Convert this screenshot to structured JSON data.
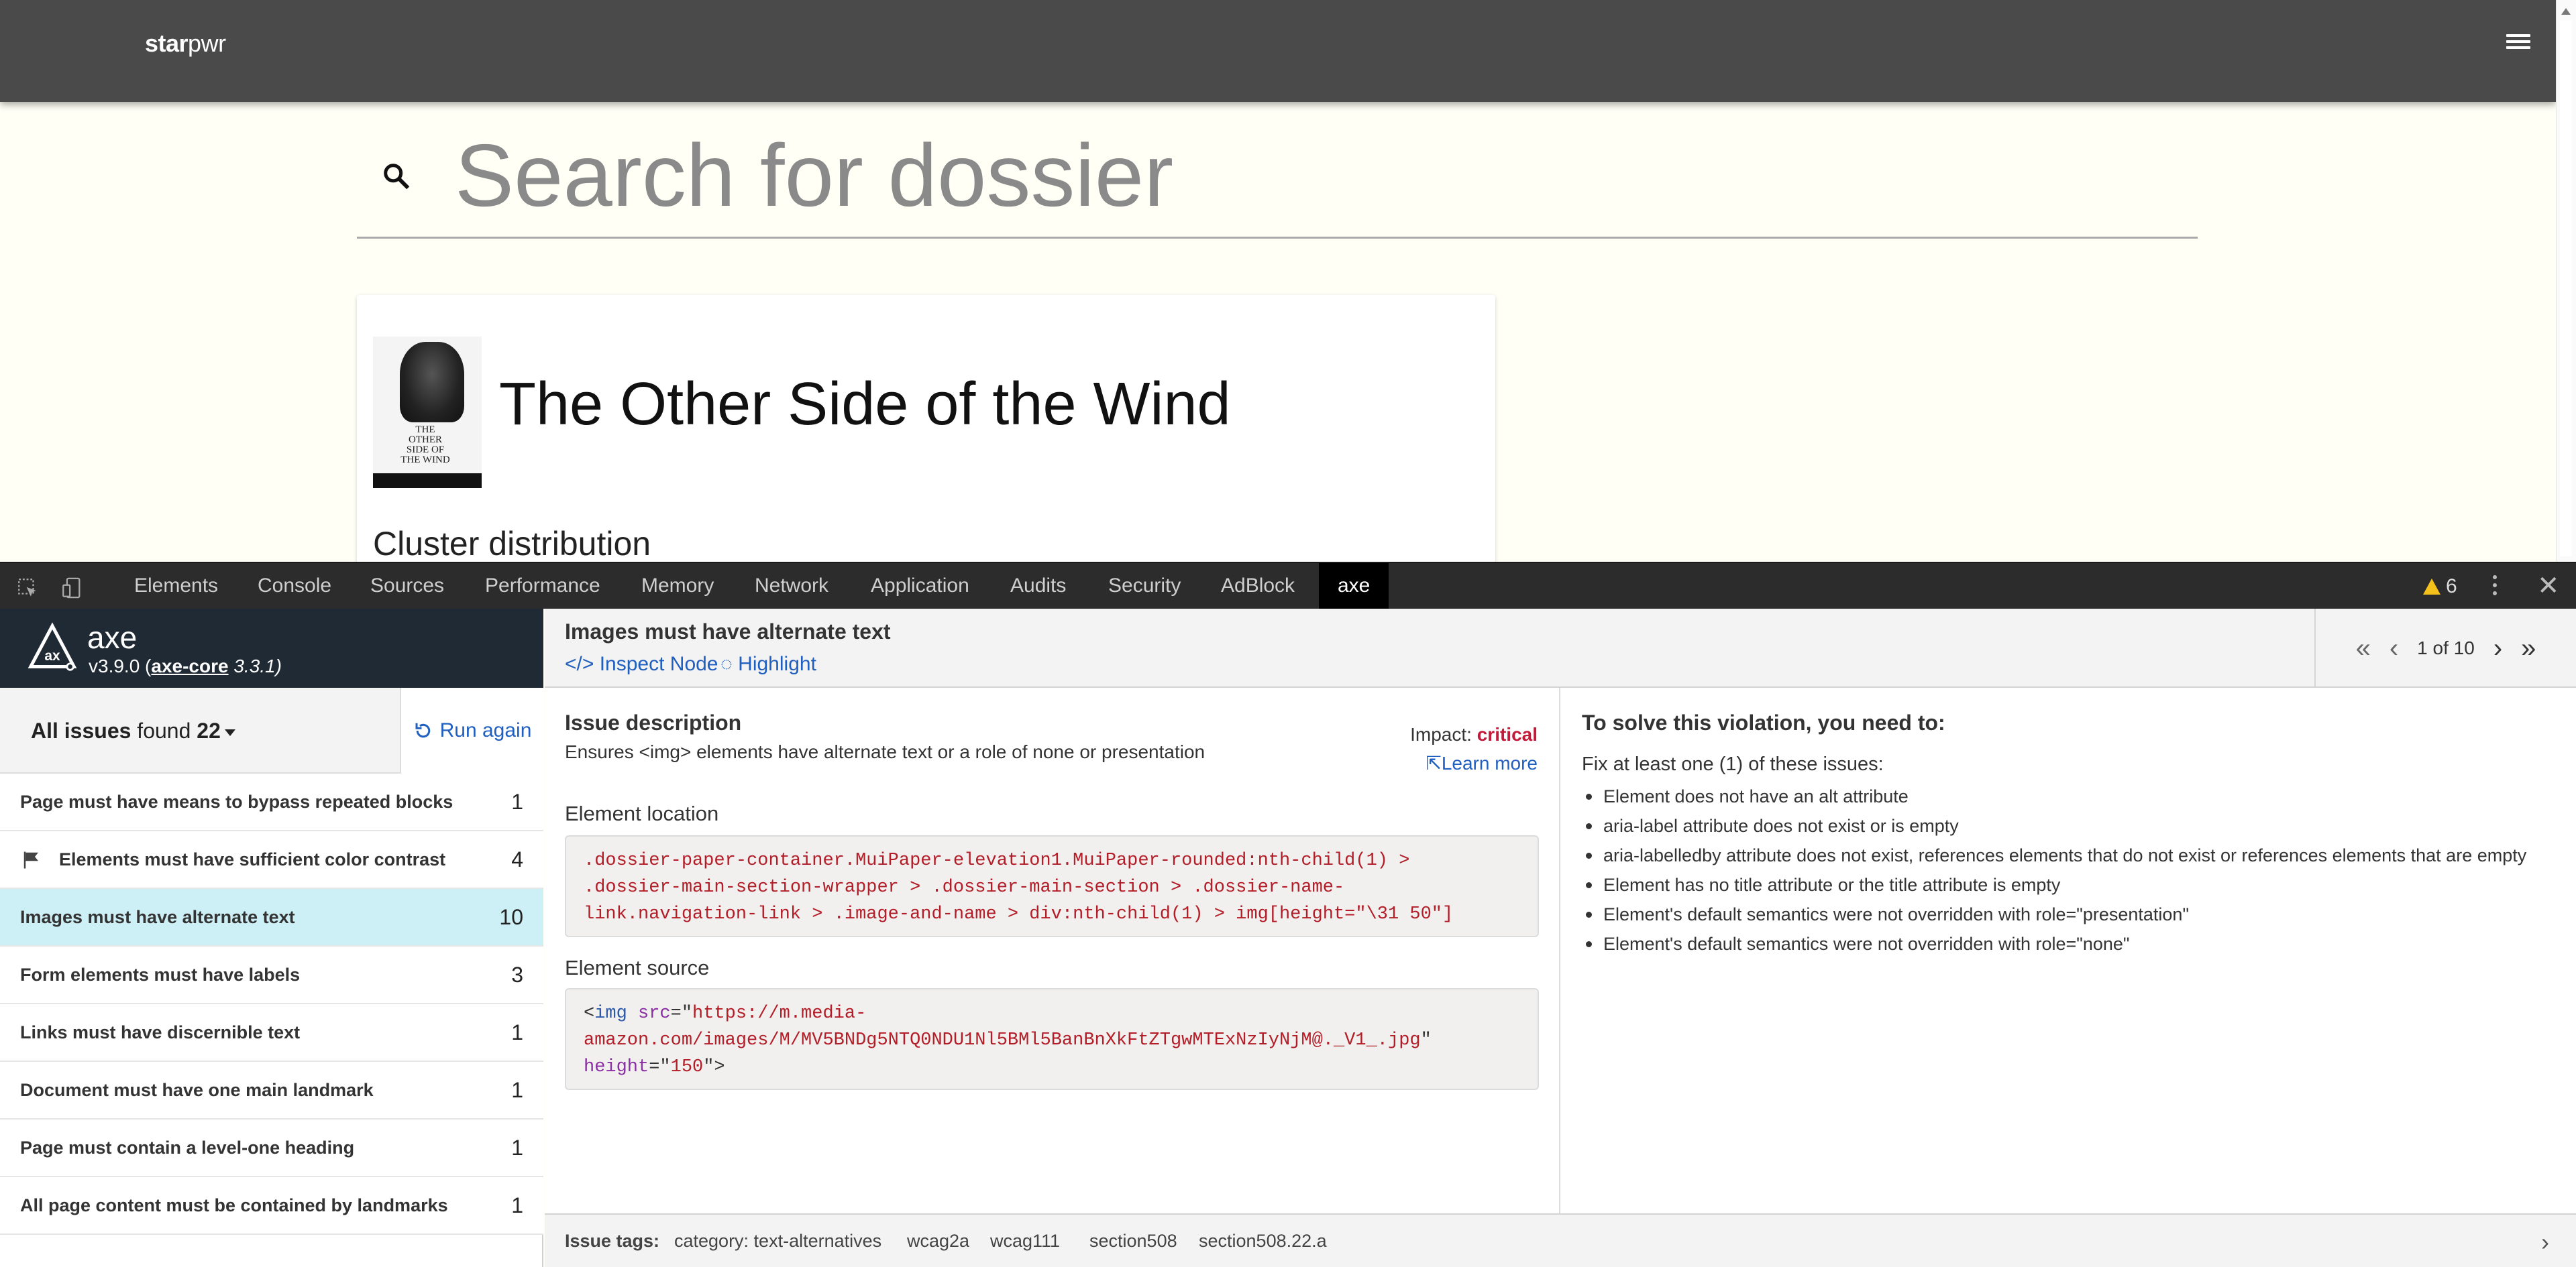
{
  "app": {
    "logo_bold": "star",
    "logo_rest": "pwr"
  },
  "search": {
    "placeholder": "Search for dossier"
  },
  "card": {
    "title": "The Other Side of the Wind",
    "section_heading": "Cluster distribution",
    "poster_text": "THE OTHER SIDE OF THE WIND"
  },
  "devtools": {
    "tabs": [
      "Elements",
      "Console",
      "Sources",
      "Performance",
      "Memory",
      "Network",
      "Application",
      "Audits",
      "Security",
      "AdBlock",
      "axe"
    ],
    "active_tab": "axe",
    "warning_count": "6"
  },
  "axe": {
    "name": "axe",
    "version_prefix": "v3.9.0 (",
    "core_link": "axe-core",
    "core_version": " 3.3.1)",
    "filter_label": "All issues",
    "found_label": " found ",
    "found_count": "22",
    "run_again": "Run again",
    "issues": [
      {
        "label": "Page must have means to bypass repeated blocks",
        "count": "1"
      },
      {
        "label": "Elements must have sufficient color contrast",
        "count": "4"
      },
      {
        "label": "Images must have alternate text",
        "count": "10"
      },
      {
        "label": "Form elements must have labels",
        "count": "3"
      },
      {
        "label": "Links must have discernible text",
        "count": "1"
      },
      {
        "label": "Document must have one main landmark",
        "count": "1"
      },
      {
        "label": "Page must contain a level-one heading",
        "count": "1"
      },
      {
        "label": "All page content must be contained by landmarks",
        "count": "1"
      }
    ],
    "selected_issue": 2
  },
  "rule": {
    "title": "Images must have alternate text",
    "inspect_node": "Inspect Node",
    "highlight": "Highlight",
    "pager": "1 of 10",
    "description_heading": "Issue description",
    "description": "Ensures <img> elements have alternate text or a role of none or presentation",
    "impact_label": "Impact: ",
    "impact_value": "critical",
    "learn_more": "Learn more",
    "location_heading": "Element location",
    "location_code": [
      ".dossier-paper-container.MuiPaper-elevation1.MuiPaper-rounded:nth-child(1) >",
      ".dossier-main-section-wrapper > .dossier-main-section > .dossier-name-",
      "link.navigation-link > .image-and-name > div:nth-child(1) > img[height=\"\\31 50\"]"
    ],
    "source_heading": "Element source",
    "source_tag": "img",
    "source_src": "https://m.media-",
    "source_src_2": "amazon.com/images/M/MV5BNDg5NTQ0NDU1Nl5BMl5BanBnXkFtZTgwMTExNzIyNjM@._V1_.jpg",
    "source_height": "150",
    "solve_heading": "To solve this violation, you need to:",
    "solve_sub": "Fix at least one (1) of these issues:",
    "solve_items": [
      "Element does not have an alt attribute",
      "aria-label attribute does not exist or is empty",
      "aria-labelledby attribute does not exist, references elements that do not exist or references elements that are empty",
      "Element has no title attribute or the title attribute is empty",
      "Element's default semantics were not overridden with role=\"presentation\"",
      "Element's default semantics were not overridden with role=\"none\""
    ],
    "tags_label": "Issue tags:",
    "tags": [
      "category: text-alternatives",
      "wcag2a",
      "wcag111",
      "section508",
      "section508.22.a"
    ]
  }
}
